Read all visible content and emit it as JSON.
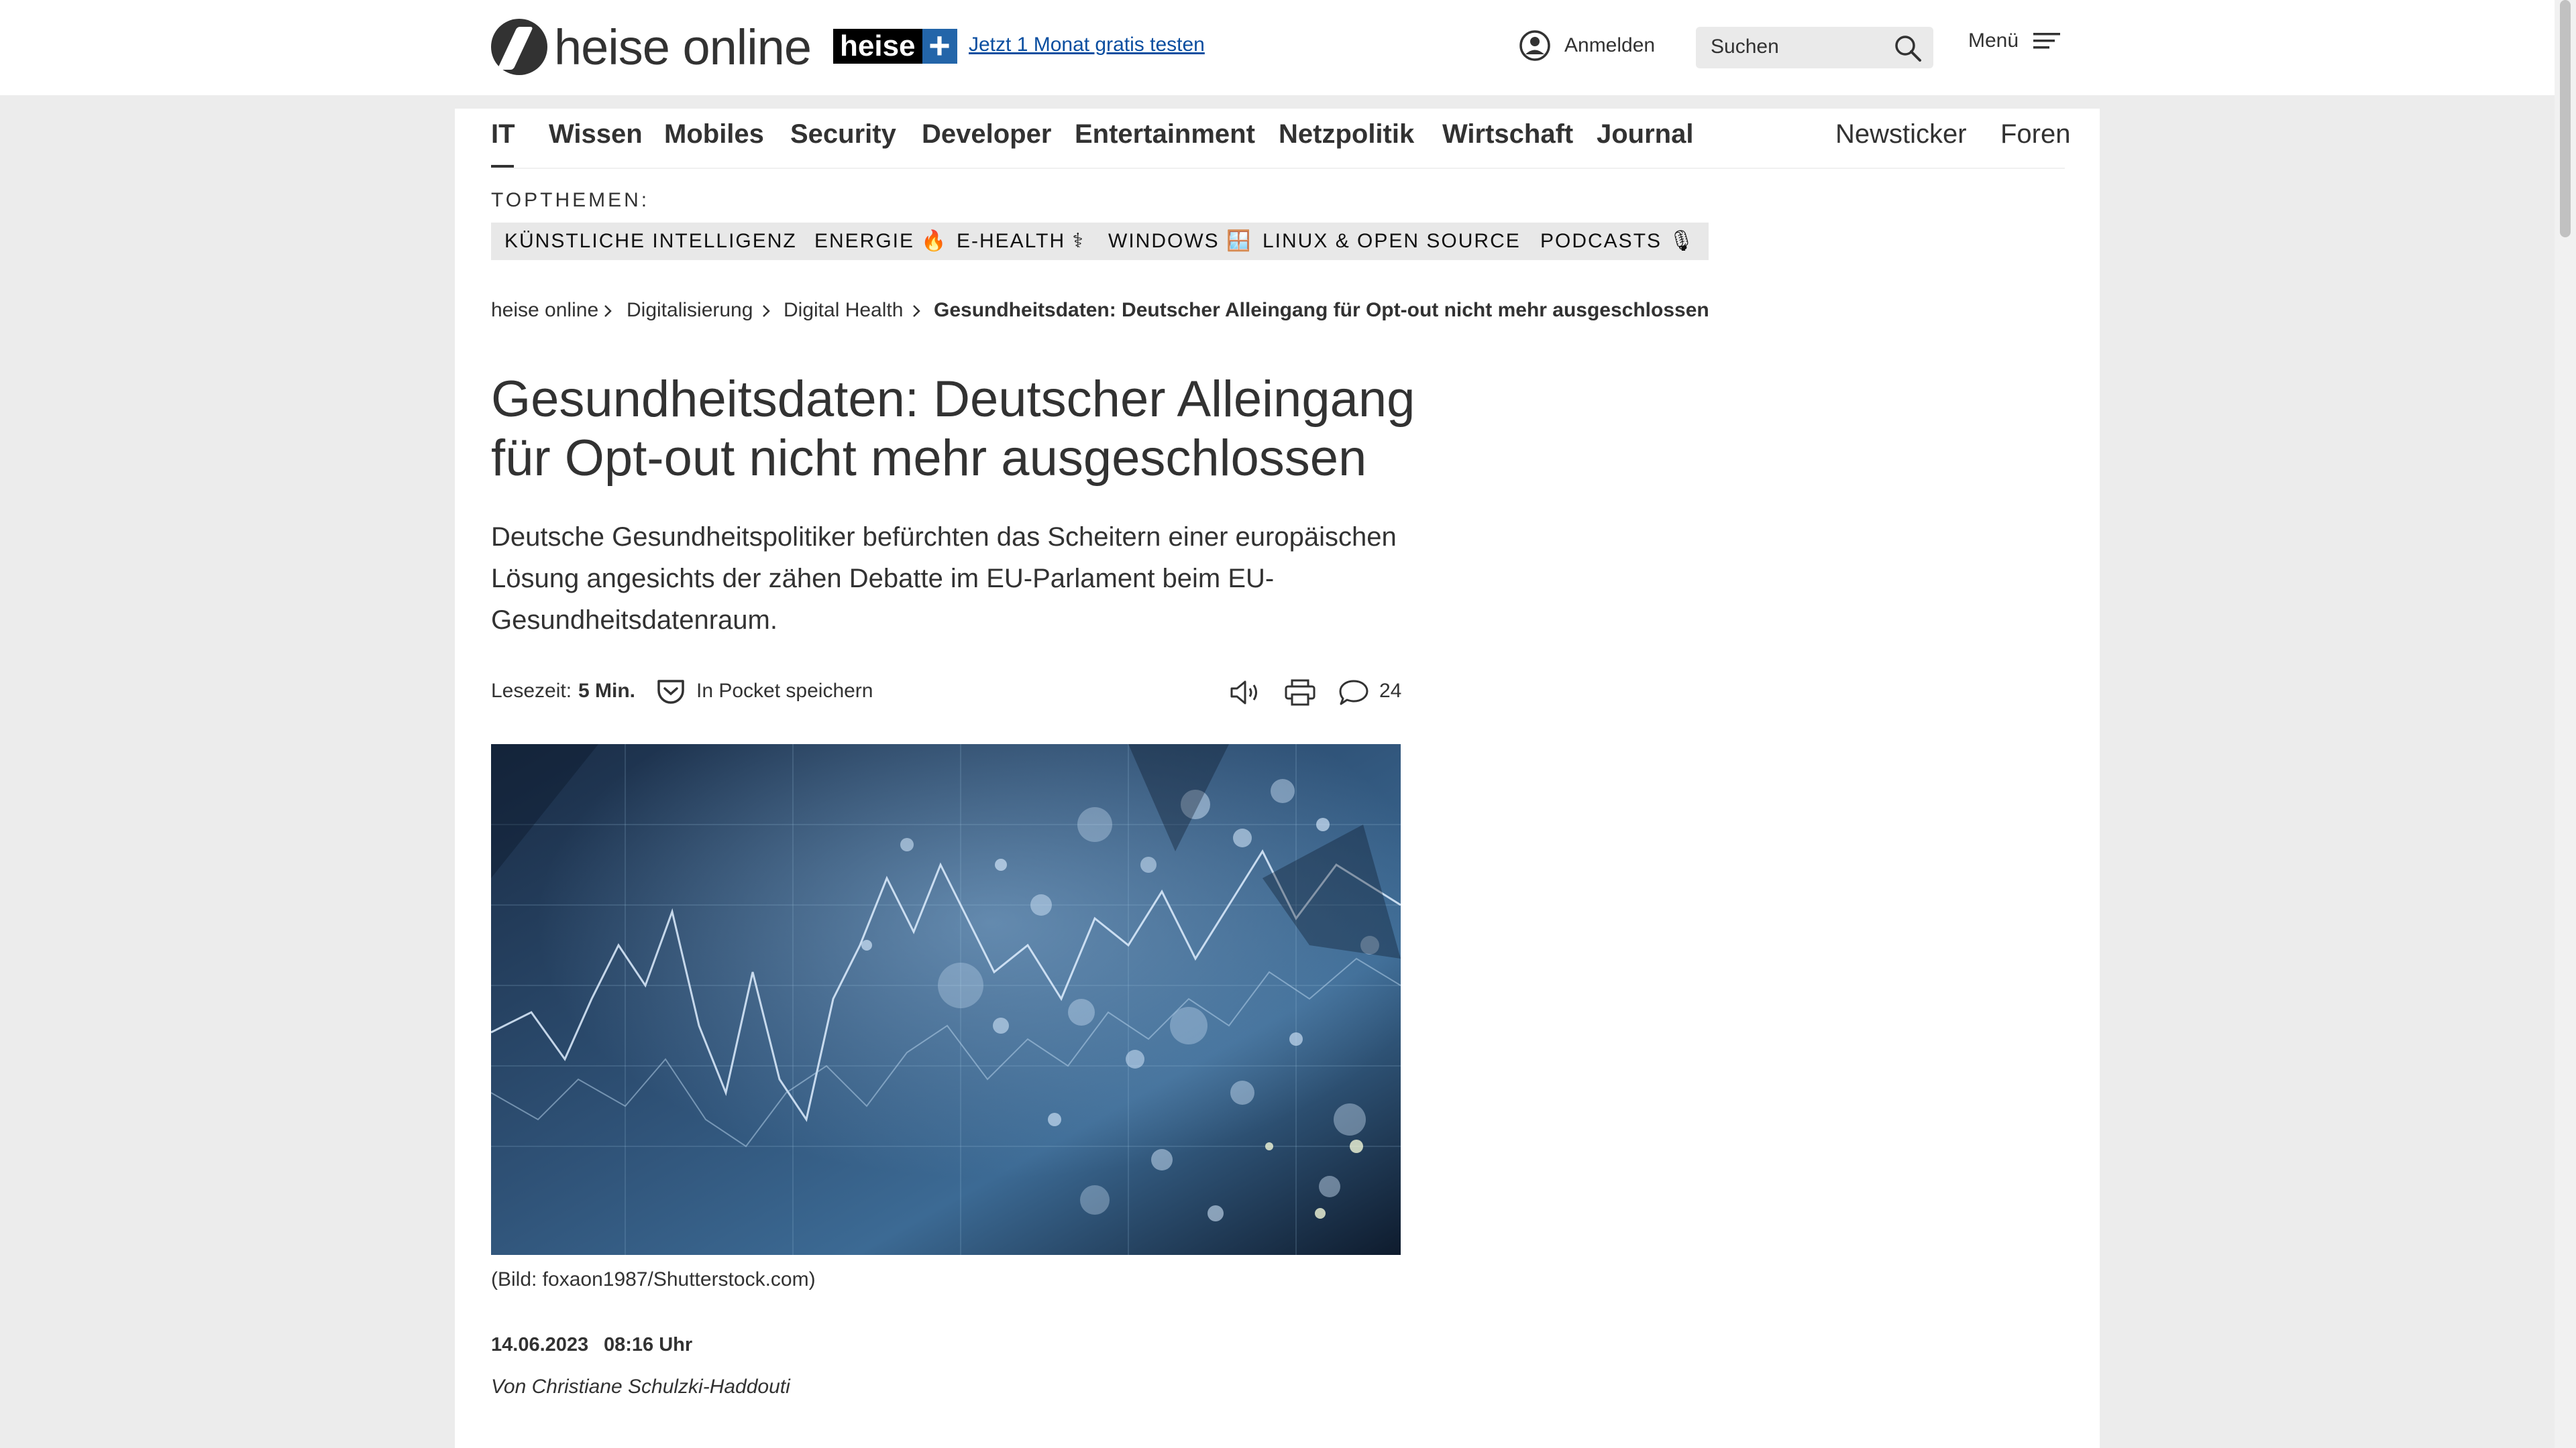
{
  "header": {
    "logo_text": "heise online",
    "plus_badge_left": "heise",
    "plus_badge_right": "+",
    "promo_link": "Jetzt 1 Monat gratis testen",
    "login_label": "Anmelden",
    "search_placeholder": "Suchen",
    "menu_label": "Menü"
  },
  "nav": {
    "items": [
      "IT",
      "Wissen",
      "Mobiles",
      "Security",
      "Developer",
      "Entertainment",
      "Netzpolitik",
      "Wirtschaft",
      "Journal"
    ],
    "right_items": [
      "Newsticker",
      "Foren"
    ],
    "active": "IT"
  },
  "topics": {
    "label": "TOPTHEMEN:",
    "items": [
      "KÜNSTLICHE INTELLIGENZ 🤖",
      "ENERGIE 🔥",
      "E-HEALTH ⚕",
      "WINDOWS 🪟",
      "LINUX & OPEN SOURCE 🐧",
      "PODCASTS 🎙"
    ]
  },
  "breadcrumb": [
    "heise online",
    "Digitalisierung",
    "Digital Health",
    "Gesundheitsdaten: Deutscher Alleingang für Opt-out nicht mehr ausgeschlossen"
  ],
  "article": {
    "title": "Gesundheitsdaten: Deutscher Alleingang für Opt-out nicht mehr ausgeschlossen",
    "lead": "Deutsche Gesundheitspolitiker befürchten das Scheitern einer europäischen Lösung angesichts der zähen Debatte im EU-Parlament beim EU-Gesundheitsdatenraum.",
    "reading_time_label": "Lesezeit:",
    "reading_time_value": "5 Min.",
    "pocket_label": "In Pocket speichern",
    "comment_count": "24",
    "image_caption": "(Bild: foxaon1987/Shutterstock.com)",
    "date": "14.06.2023",
    "time": "08:16 Uhr",
    "author": "Von Christiane Schulzki-Haddouti"
  },
  "colors": {
    "text": "#323232",
    "link": "#0a4ea0",
    "plus_blue": "#2365a9",
    "chip_bg": "#e8e8e8",
    "page_bg": "#ececec"
  },
  "icons": [
    "user-circle-icon",
    "search-icon",
    "hamburger-icon",
    "chevron-right-icon",
    "pocket-icon",
    "speaker-icon",
    "print-icon",
    "comment-icon"
  ]
}
